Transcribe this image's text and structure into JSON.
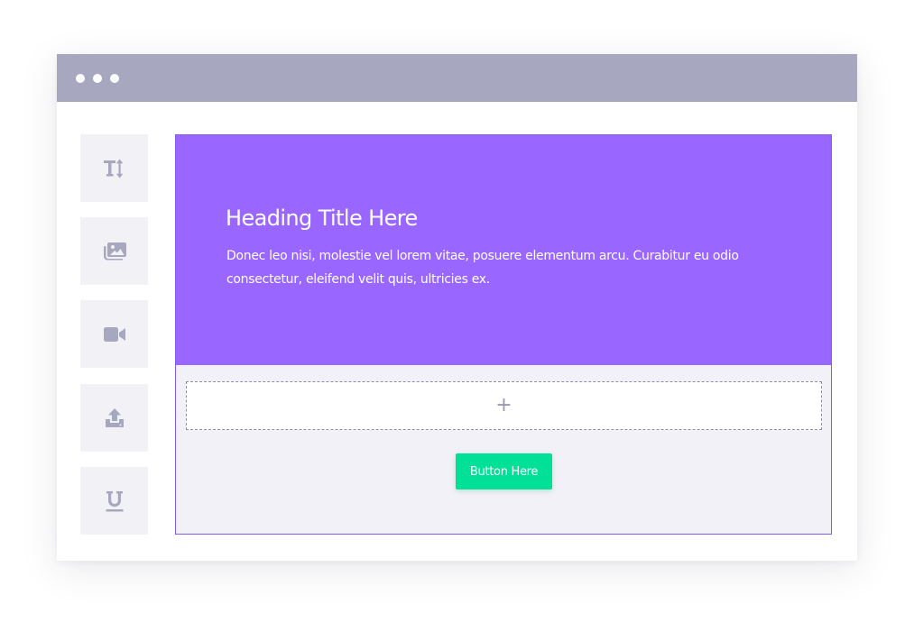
{
  "window": {
    "titlebar_color": "#a7a8bf",
    "controls": [
      "dot",
      "dot",
      "dot"
    ]
  },
  "sidebar": {
    "tools": [
      {
        "name": "text-size-icon"
      },
      {
        "name": "image-gallery-icon"
      },
      {
        "name": "video-camera-icon"
      },
      {
        "name": "upload-icon"
      },
      {
        "name": "underline-icon"
      }
    ],
    "tile_color": "#f1f1f6",
    "icon_color": "#a7a8bf"
  },
  "hero": {
    "background": "#9966ff",
    "title": "Heading Title Here",
    "body": "Donec leo nisi, molestie vel lorem vitae, posuere elementum arcu. Curabitur eu odio consectetur, eleifend velit quis, ultricies ex."
  },
  "dropzone": {
    "label": "+"
  },
  "cta": {
    "label": "Button Here",
    "color": "#00e096"
  }
}
